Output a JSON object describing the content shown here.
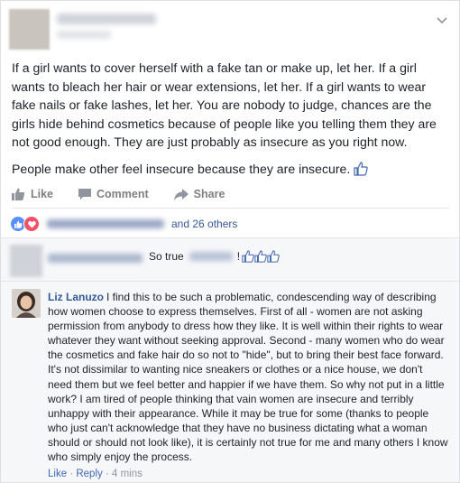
{
  "post": {
    "paragraphs": [
      "If a girl wants to cover herself with a fake tan or make up, let her. If a girl wants to bleach her hair or wear extensions, let her. If a girl wants to wear fake nails or fake lashes, let her. You are nobody to judge, chances are the girls hide behind cosmetics because of people like you telling them they are not good enough. They are just probably as insecure as you right now.",
      "People make other feel insecure because they are insecure."
    ]
  },
  "actions": {
    "like": "Like",
    "comment": "Comment",
    "share": "Share"
  },
  "reactions": {
    "others_text": "and 26 others"
  },
  "comments": [
    {
      "text_before": "So true",
      "text_after": "!"
    },
    {
      "author": "Liz Lanuzo",
      "text": "I find this to be such a problematic, condescending way of describing how women choose to express themselves. First of all - women are not asking permission from anybody to dress how they like. It is well within their rights to wear whatever they want without seeking approval. Second - many women who do wear the cosmetics and fake hair do so not to \"hide\", but to bring their best face forward. It's not dissimilar to wanting nice sneakers or clothes or a nice house, we don't need them but we feel better and happier if we have them. So why not put in a little work? I am tired of people thinking that vain women are insecure and terribly unhappy with their appearance. While it may be true for some (thanks to people who just can't acknowledge that they have no business dictating what a woman should or should not look like), it is certainly not true for me and many others I know who simply enjoy the process.",
      "like_label": "Like",
      "sep": "·",
      "reply_label": "Reply",
      "time": "4 mins"
    }
  ],
  "colors": {
    "link": "#365899",
    "text": "#1d2129",
    "muted": "#90949c"
  }
}
